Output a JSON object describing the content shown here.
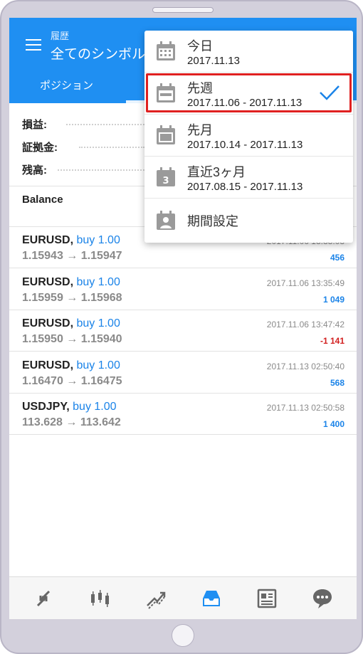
{
  "header": {
    "subtitle": "履歴",
    "title": "全てのシンボル",
    "tabs": [
      {
        "label": "ポジション"
      }
    ]
  },
  "summary": {
    "profit_label": "損益:",
    "margin_label": "証拠金:",
    "balance_label": "残高:"
  },
  "balance_section": {
    "label": "Balance"
  },
  "deals": [
    {
      "symbol": "EURUSD,",
      "side": "buy 1.00",
      "prices": "1.15943 → 1.15947",
      "time": "2017.11.06 13:33:03",
      "profit": "456",
      "profit_type": "pos"
    },
    {
      "symbol": "EURUSD,",
      "side": "buy 1.00",
      "prices": "1.15959 → 1.15968",
      "time": "2017.11.06 13:35:49",
      "profit": "1 049",
      "profit_type": "pos"
    },
    {
      "symbol": "EURUSD,",
      "side": "buy 1.00",
      "prices": "1.15950 → 1.15940",
      "time": "2017.11.06 13:47:42",
      "profit": "-1 141",
      "profit_type": "neg"
    },
    {
      "symbol": "EURUSD,",
      "side": "buy 1.00",
      "prices": "1.16470 → 1.16475",
      "time": "2017.11.13 02:50:40",
      "profit": "568",
      "profit_type": "pos"
    },
    {
      "symbol": "USDJPY,",
      "side": "buy 1.00",
      "prices": "113.628 → 113.642",
      "time": "2017.11.13 02:50:58",
      "profit": "1 400",
      "profit_type": "pos"
    }
  ],
  "period_menu": {
    "items": [
      {
        "label": "今日",
        "range": "2017.11.13",
        "icon": "calendar-dots-icon"
      },
      {
        "label": "先週",
        "range": "2017.11.06 - 2017.11.13",
        "icon": "calendar-week-icon",
        "selected": true
      },
      {
        "label": "先月",
        "range": "2017.10.14 - 2017.11.13",
        "icon": "calendar-month-icon"
      },
      {
        "label": "直近3ヶ月",
        "range": "2017.08.15 - 2017.11.13",
        "icon": "calendar-3-icon",
        "badge": "3"
      },
      {
        "label": "期間設定",
        "icon": "calendar-person-icon"
      }
    ]
  },
  "bottom_nav": [
    "quotes-icon",
    "chart-icon",
    "trade-icon",
    "history-icon",
    "news-icon",
    "chat-icon"
  ],
  "colors": {
    "accent": "#1f8ff2",
    "profit": "#1a83e8",
    "loss": "#d21f1f",
    "highlight": "#e02020"
  }
}
